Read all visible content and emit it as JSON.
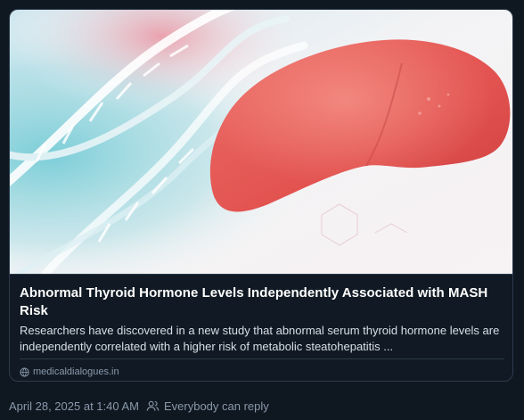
{
  "link_card": {
    "title": "Abnormal Thyroid Hormone Levels Independently Associated with MASH Risk",
    "description": "Researchers have discovered in a new study that abnormal serum thyroid hormone levels are independently correlated with a higher risk of metabolic steatohepatitis ...",
    "source": "medicaldialogues.in",
    "source_icon": "globe-icon",
    "image_alt": "liver illustration with DNA strands"
  },
  "post_meta": {
    "timestamp": "April 28, 2025 at 1:40 AM",
    "reply_setting": "Everybody can reply",
    "reply_icon": "people-icon"
  },
  "colors": {
    "background": "#0f1720",
    "card_border": "#2c3b4c",
    "title": "#ffffff",
    "description": "#d7dee7",
    "muted": "#8a99ab",
    "liver": "#e8605c"
  }
}
